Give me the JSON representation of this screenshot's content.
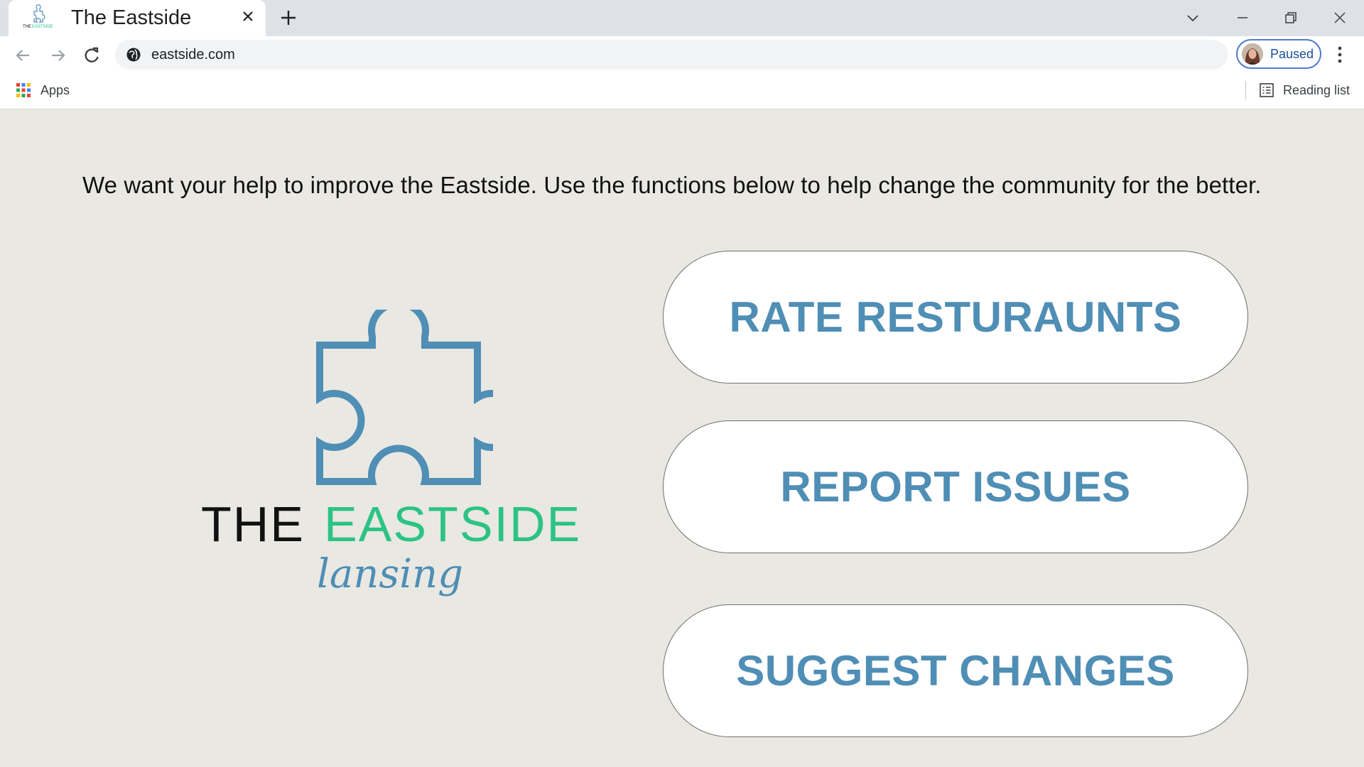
{
  "browser": {
    "tab": {
      "title": "The Eastside"
    },
    "address_bar": {
      "url": "eastside.com"
    },
    "profile": {
      "status": "Paused"
    },
    "bookmarks_bar": {
      "apps_label": "Apps",
      "reading_list_label": "Reading list"
    }
  },
  "page": {
    "intro_text": "We want your help to improve the Eastside. Use the functions below to help change the community for the better.",
    "logo": {
      "line1_dark": "THE",
      "line1_accent": "EASTSIDE",
      "line2": "lansing"
    },
    "actions": [
      {
        "label": "RATE RESTURAUNTS"
      },
      {
        "label": "REPORT ISSUES"
      },
      {
        "label": "SUGGEST CHANGES"
      }
    ]
  },
  "colors": {
    "page_background": "#e9e8e2",
    "brand_blue": "#4f8eb5",
    "brand_green": "#2cc385"
  }
}
